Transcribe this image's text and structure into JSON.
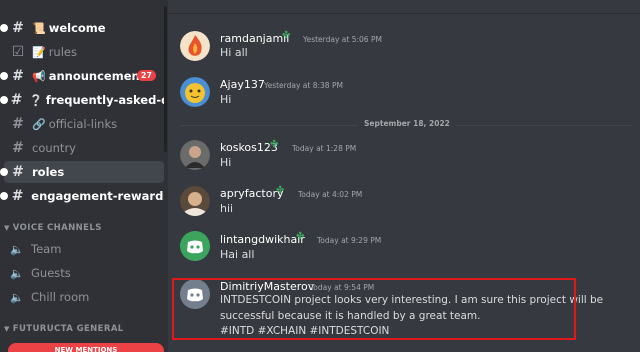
{
  "sidebar": {
    "channels": [
      {
        "label": "welcome",
        "emoji": "📜",
        "unread": true
      },
      {
        "label": "rules",
        "emoji": "📝",
        "unread": false
      },
      {
        "label": "announcements",
        "emoji": "📢",
        "unread": true,
        "badge": "27"
      },
      {
        "label": "frequently-asked-qu...",
        "emoji": "❔",
        "unread": true
      },
      {
        "label": "official-links",
        "emoji": "🔗",
        "unread": false
      },
      {
        "label": "country",
        "emoji": "",
        "unread": false
      },
      {
        "label": "roles",
        "emoji": "",
        "unread": true,
        "active": true
      },
      {
        "label": "engagement-rewards",
        "emoji": "",
        "unread": true
      }
    ],
    "voice_category": "VOICE CHANNELS",
    "voice_channels": [
      "Team",
      "Guests",
      "Chill room"
    ],
    "futuructa_category": "FUTURUCTA GENERAL",
    "new_mentions": "NEW MENTIONS"
  },
  "messages": [
    {
      "user": "ramdanjamil",
      "time": "Yesterday at 5:06 PM",
      "text": "Hi all",
      "badge": "leaf-icon"
    },
    {
      "user": "Ajay137",
      "time": "Yesterday at 8:38 PM",
      "text": "Hi"
    },
    {
      "user": "koskos123",
      "time": "Today at 1:28 PM",
      "text": "Hi",
      "badge": "leaf-icon"
    },
    {
      "user": "apryfactory",
      "time": "Today at 4:02 PM",
      "text": "hii",
      "badge": "leaf-icon"
    },
    {
      "user": "lintangdwikhair",
      "time": "Today at 9:29 PM",
      "text": "Hai all",
      "badge": "leaf-icon"
    },
    {
      "user": "DimitriyMasterov",
      "time": "Today at 9:54 PM",
      "lines": [
        "INTDESTCOIN project looks very interesting. I am sure this project will be",
        "successful because it is handled by a great team.",
        "#INTD #XCHAIN #INTDESTCOIN"
      ]
    }
  ],
  "date_divider": "September 18, 2022",
  "colors": {
    "accent": "#5865f2",
    "mention": "#ed4245",
    "highlight": "#e0191b",
    "online": "#3ba55d"
  }
}
